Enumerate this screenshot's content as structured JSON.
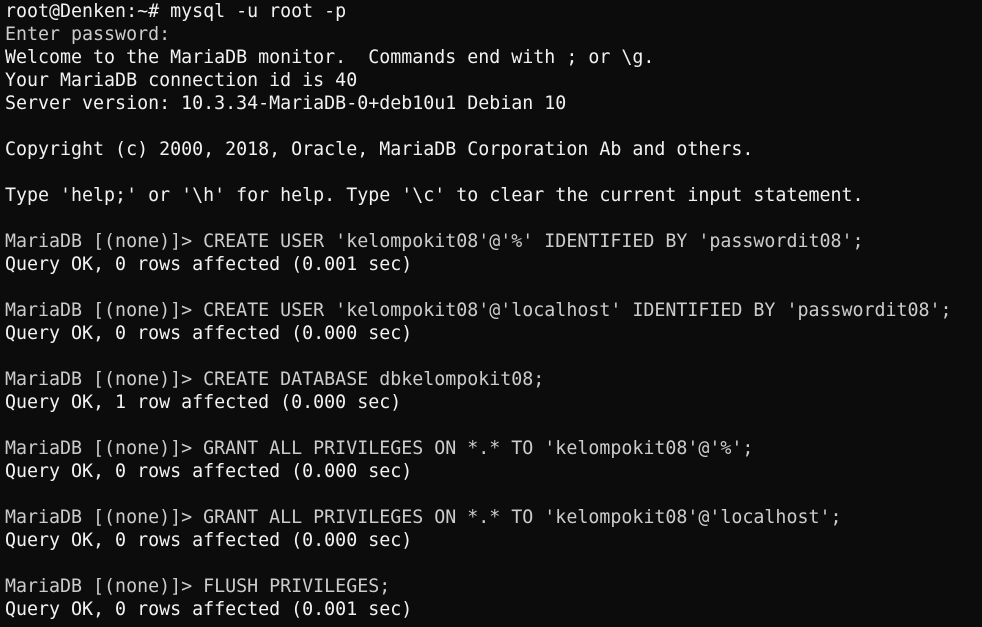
{
  "colors": {
    "background": "#0c0c0c",
    "foreground": "#cccccc",
    "bright_foreground": "#f2f2f2"
  },
  "terminal": {
    "lines": [
      "root@Denken:~# mysql -u root -p",
      "Enter password:",
      "Welcome to the MariaDB monitor.  Commands end with ; or \\g.",
      "Your MariaDB connection id is 40",
      "Server version: 10.3.34-MariaDB-0+deb10u1 Debian 10",
      "",
      "Copyright (c) 2000, 2018, Oracle, MariaDB Corporation Ab and others.",
      "",
      "Type 'help;' or '\\h' for help. Type '\\c' to clear the current input statement.",
      "",
      "MariaDB [(none)]> CREATE USER 'kelompokit08'@'%' IDENTIFIED BY 'passwordit08';",
      "Query OK, 0 rows affected (0.001 sec)",
      "",
      "MariaDB [(none)]> CREATE USER 'kelompokit08'@'localhost' IDENTIFIED BY 'passwordit08';",
      "Query OK, 0 rows affected (0.000 sec)",
      "",
      "MariaDB [(none)]> CREATE DATABASE dbkelompokit08;",
      "Query OK, 1 row affected (0.000 sec)",
      "",
      "MariaDB [(none)]> GRANT ALL PRIVILEGES ON *.* TO 'kelompokit08'@'%';",
      "Query OK, 0 rows affected (0.000 sec)",
      "",
      "MariaDB [(none)]> GRANT ALL PRIVILEGES ON *.* TO 'kelompokit08'@'localhost';",
      "Query OK, 0 rows affected (0.000 sec)",
      "",
      "MariaDB [(none)]> FLUSH PRIVILEGES;",
      "Query OK, 0 rows affected (0.001 sec)"
    ]
  }
}
